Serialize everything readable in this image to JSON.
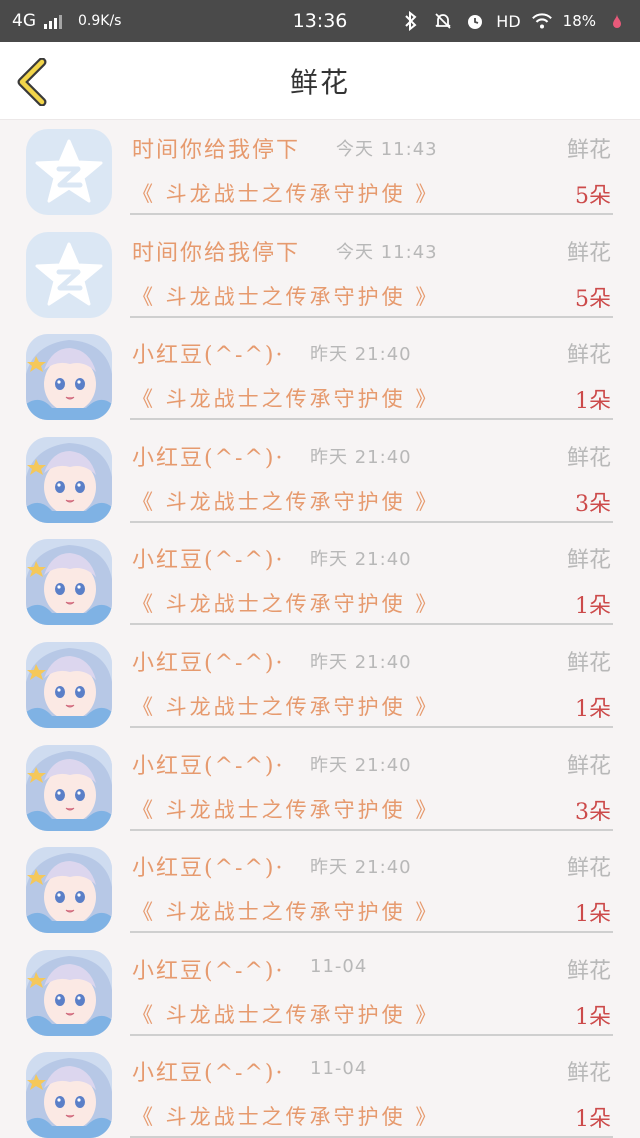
{
  "status_bar": {
    "network": "4G",
    "speed": "0.9K/s",
    "time": "13:36",
    "hd": "HD",
    "battery": "18%"
  },
  "header": {
    "title": "鲜花",
    "back_icon": "chevron-left-icon"
  },
  "colors": {
    "accent": "#e69a6e",
    "count": "#cc4a4a",
    "muted": "#b8b8b8"
  },
  "rows": [
    {
      "avatar": "qq",
      "name": "时间你给我停下",
      "time": "今天 11:43",
      "type": "鲜花",
      "book": "《 斗龙战士之传承守护使 》",
      "count": "5朵"
    },
    {
      "avatar": "qq",
      "name": "时间你给我停下",
      "time": "今天 11:43",
      "type": "鲜花",
      "book": "《 斗龙战士之传承守护使 》",
      "count": "5朵"
    },
    {
      "avatar": "anime",
      "name": "小红豆(^-^)·",
      "time": "昨天 21:40",
      "type": "鲜花",
      "book": "《 斗龙战士之传承守护使 》",
      "count": "1朵"
    },
    {
      "avatar": "anime",
      "name": "小红豆(^-^)·",
      "time": "昨天 21:40",
      "type": "鲜花",
      "book": "《 斗龙战士之传承守护使 》",
      "count": "3朵"
    },
    {
      "avatar": "anime",
      "name": "小红豆(^-^)·",
      "time": "昨天 21:40",
      "type": "鲜花",
      "book": "《 斗龙战士之传承守护使 》",
      "count": "1朵"
    },
    {
      "avatar": "anime",
      "name": "小红豆(^-^)·",
      "time": "昨天 21:40",
      "type": "鲜花",
      "book": "《 斗龙战士之传承守护使 》",
      "count": "1朵"
    },
    {
      "avatar": "anime",
      "name": "小红豆(^-^)·",
      "time": "昨天 21:40",
      "type": "鲜花",
      "book": "《 斗龙战士之传承守护使 》",
      "count": "3朵"
    },
    {
      "avatar": "anime",
      "name": "小红豆(^-^)·",
      "time": "昨天 21:40",
      "type": "鲜花",
      "book": "《 斗龙战士之传承守护使 》",
      "count": "1朵"
    },
    {
      "avatar": "anime",
      "name": "小红豆(^-^)·",
      "time": "11-04",
      "type": "鲜花",
      "book": "《 斗龙战士之传承守护使 》",
      "count": "1朵"
    },
    {
      "avatar": "anime",
      "name": "小红豆(^-^)·",
      "time": "11-04",
      "type": "鲜花",
      "book": "《 斗龙战士之传承守护使 》",
      "count": "1朵"
    }
  ]
}
